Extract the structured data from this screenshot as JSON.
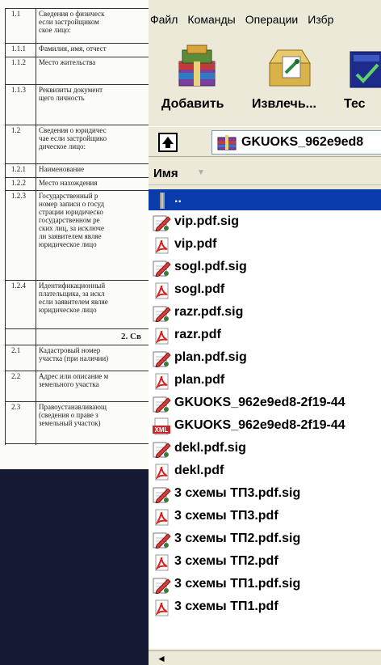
{
  "document": {
    "rows": [
      {
        "num": "1.1",
        "text": [
          "Сведения о физическ",
          "если застройщиком",
          "ское лицо:"
        ]
      },
      {
        "num": "1.1.1",
        "text": [
          "Фамилия, имя, отчест"
        ]
      },
      {
        "num": "1.1.2",
        "text": [
          "Место жительства"
        ]
      },
      {
        "num": "1.1.3",
        "text": [
          "Реквизиты документ",
          "щего личность"
        ]
      },
      {
        "num": "1.2",
        "text": [
          "Сведения о юридичес",
          "чае если застройщико",
          "дическое лицо:"
        ]
      },
      {
        "num": "1.2.1",
        "text": [
          "Наименование"
        ]
      },
      {
        "num": "1.2.2",
        "text": [
          "Место нахождения"
        ]
      },
      {
        "num": "1.2.3",
        "text": [
          "Государственный р",
          "номер записи о госуд",
          "страции юридическо",
          "государственном ре",
          "ских лиц, за исключе",
          "ли заявителем являе",
          "юридическое лицо"
        ]
      },
      {
        "num": "1.2.4",
        "text": [
          "Идентификационный",
          "плательщика, за искл",
          "если заявителем являе",
          "юридическое лицо"
        ]
      },
      {
        "num": "",
        "text": [
          "2. Св"
        ]
      },
      {
        "num": "2.1",
        "text": [
          "Кадастровый номер",
          "участка (при наличии)"
        ]
      },
      {
        "num": "2.2",
        "text": [
          "Адрес или описание м",
          "земельного участка"
        ]
      },
      {
        "num": "2.3",
        "text": [
          "Правоустанавливающ",
          "(сведения о праве з",
          "земельный участок)"
        ]
      }
    ]
  },
  "menu": [
    "Файл",
    "Команды",
    "Операции",
    "Избр"
  ],
  "toolbar": [
    {
      "label": "Добавить",
      "icon": "add-archive-icon"
    },
    {
      "label": "Извлечь...",
      "icon": "extract-icon"
    },
    {
      "label": "Тес",
      "icon": "test-icon"
    }
  ],
  "path": {
    "text": "GKUOKS_962e9ed8"
  },
  "columns": {
    "name": "Имя"
  },
  "files": [
    {
      "name": "..",
      "type": "parent",
      "selected": true
    },
    {
      "name": "vip.pdf.sig",
      "type": "sig"
    },
    {
      "name": "vip.pdf",
      "type": "pdf"
    },
    {
      "name": "sogl.pdf.sig",
      "type": "sig"
    },
    {
      "name": "sogl.pdf",
      "type": "pdf"
    },
    {
      "name": "razr.pdf.sig",
      "type": "sig"
    },
    {
      "name": "razr.pdf",
      "type": "pdf"
    },
    {
      "name": "plan.pdf.sig",
      "type": "sig"
    },
    {
      "name": "plan.pdf",
      "type": "pdf"
    },
    {
      "name": "GKUOKS_962e9ed8-2f19-44",
      "type": "sig"
    },
    {
      "name": "GKUOKS_962e9ed8-2f19-44",
      "type": "xml"
    },
    {
      "name": "dekl.pdf.sig",
      "type": "sig"
    },
    {
      "name": "dekl.pdf",
      "type": "pdf"
    },
    {
      "name": "3 схемы ТП3.pdf.sig",
      "type": "sig"
    },
    {
      "name": "3 схемы ТП3.pdf",
      "type": "pdf"
    },
    {
      "name": "3 схемы ТП2.pdf.sig",
      "type": "sig"
    },
    {
      "name": "3 схемы ТП2.pdf",
      "type": "pdf"
    },
    {
      "name": "3 схемы ТП1.pdf.sig",
      "type": "sig"
    },
    {
      "name": "3 схемы ТП1.pdf",
      "type": "pdf"
    }
  ],
  "colors": {
    "selection": "#0b3cae",
    "window": "#ece9d8",
    "backdrop": "#141a33"
  }
}
